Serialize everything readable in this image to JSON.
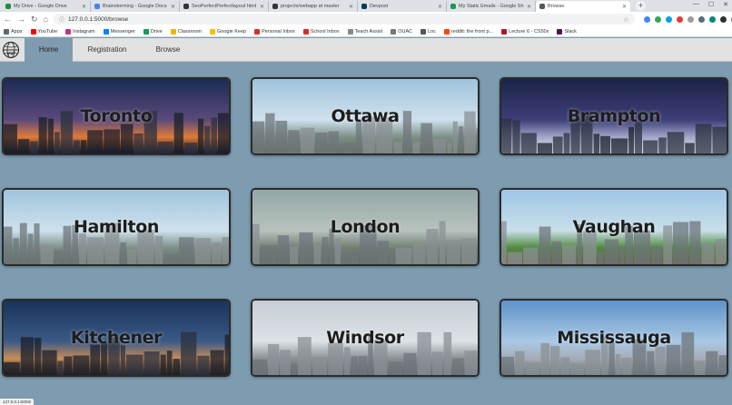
{
  "browser": {
    "tabs": [
      {
        "title": "My Drive - Google Drive",
        "color": "#1e8e3e"
      },
      {
        "title": "Brainstorming - Google Docs",
        "color": "#4285f4"
      },
      {
        "title": "SeoPerfectPerfectlayout html",
        "color": "#333333"
      },
      {
        "title": "projects/webapp at master",
        "color": "#333333"
      },
      {
        "title": "Devpost",
        "color": "#003e54"
      },
      {
        "title": "My Static Emails - Google Sh",
        "color": "#0f9d58"
      },
      {
        "title": "Browse",
        "color": "#555555"
      }
    ],
    "url": "127.0.0.1:5000/browse",
    "bookmarks": [
      {
        "label": "Apps",
        "color": "#666666"
      },
      {
        "label": "YouTube",
        "color": "#ff0000"
      },
      {
        "label": "Instagram",
        "color": "#c13584"
      },
      {
        "label": "Messenger",
        "color": "#0084ff"
      },
      {
        "label": "Drive",
        "color": "#0f9d58"
      },
      {
        "label": "Classroom",
        "color": "#f4b400"
      },
      {
        "label": "Google Keep",
        "color": "#fbbc04"
      },
      {
        "label": "Personal Inbox",
        "color": "#d93025"
      },
      {
        "label": "School Inbox",
        "color": "#d93025"
      },
      {
        "label": "Teach Assist",
        "color": "#888888"
      },
      {
        "label": "OUAC",
        "color": "#777777"
      },
      {
        "label": "Loc",
        "color": "#555555"
      },
      {
        "label": "reddit: the front p...",
        "color": "#ff4500"
      },
      {
        "label": "Lecture 6 - CS50x",
        "color": "#a51c30"
      },
      {
        "label": "Slack",
        "color": "#4a154b"
      }
    ],
    "status": "127.0.0.1:5000/"
  },
  "nav": {
    "items": [
      {
        "label": "Home",
        "active": true
      },
      {
        "label": "Registration",
        "active": false
      },
      {
        "label": "Browse",
        "active": false
      }
    ]
  },
  "cities": [
    {
      "name": "Toronto",
      "scene": "night"
    },
    {
      "name": "Ottawa",
      "scene": "day"
    },
    {
      "name": "Brampton",
      "scene": "winter"
    },
    {
      "name": "Hamilton",
      "scene": "day"
    },
    {
      "name": "London",
      "scene": "aerial"
    },
    {
      "name": "Vaughan",
      "scene": "park"
    },
    {
      "name": "Kitchener",
      "scene": "dusk"
    },
    {
      "name": "Windsor",
      "scene": "pale"
    },
    {
      "name": "Mississauga",
      "scene": "sky"
    }
  ]
}
